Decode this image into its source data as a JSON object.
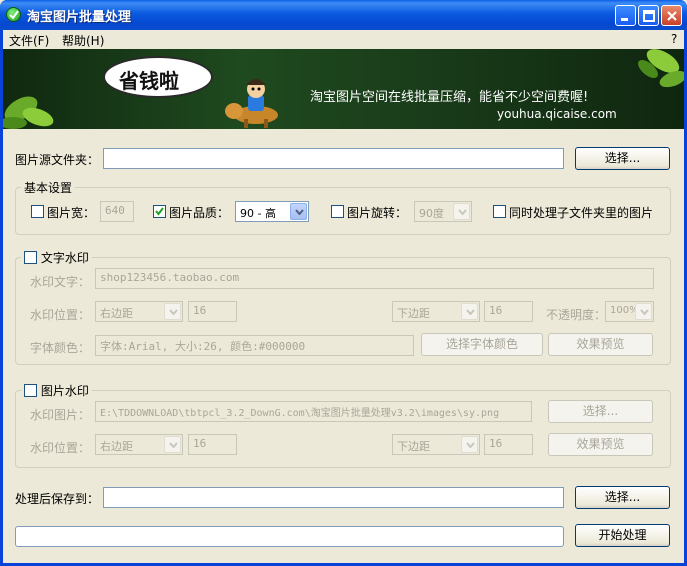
{
  "window": {
    "title": "淘宝图片批量处理"
  },
  "menu": {
    "file": "文件(F)",
    "help": "帮助(H)",
    "question": "?"
  },
  "banner": {
    "bubble": "省钱啦",
    "tagline": "淘宝图片空间在线批量压缩，能省不少空间费喔!",
    "url": "youhua.qicaise.com"
  },
  "source": {
    "label": "图片源文件夹：",
    "value": "",
    "button": "选择..."
  },
  "basic": {
    "title": "基本设置",
    "width_label": "图片宽：",
    "width_value": "640",
    "width_checked": false,
    "quality_label": "图片品质：",
    "quality_value": "90 - 高",
    "quality_checked": true,
    "rotate_label": "图片旋转：",
    "rotate_value": "90度",
    "rotate_checked": false,
    "subfolder_label": "同时处理子文件夹里的图片",
    "subfolder_checked": false
  },
  "text_wm": {
    "title": "文字水印",
    "checked": false,
    "text_label": "水印文字：",
    "text_value": "shop123456.taobao.com",
    "pos_label": "水印位置：",
    "h_select": "右边距",
    "h_value": "16",
    "v_select": "下边距",
    "v_value": "16",
    "opacity_label": "不透明度：",
    "opacity_value": "100%",
    "font_label": "字体颜色：",
    "font_value": "字体:Arial, 大小:26, 颜色:#000000",
    "font_button": "选择字体颜色",
    "preview_button": "效果预览"
  },
  "image_wm": {
    "title": "图片水印",
    "checked": false,
    "image_label": "水印图片：",
    "image_value": "E:\\TDDOWNLOAD\\tbtpcl_3.2_DownG.com\\淘宝图片批量处理v3.2\\images\\sy.png",
    "choose_button": "选择...",
    "pos_label": "水印位置：",
    "h_select": "右边距",
    "h_value": "16",
    "v_select": "下边距",
    "v_value": "16",
    "preview_button": "效果预览"
  },
  "output": {
    "label": "处理后保存到：",
    "value": "",
    "button": "选择..."
  },
  "start_button": "开始处理",
  "progress": 0
}
